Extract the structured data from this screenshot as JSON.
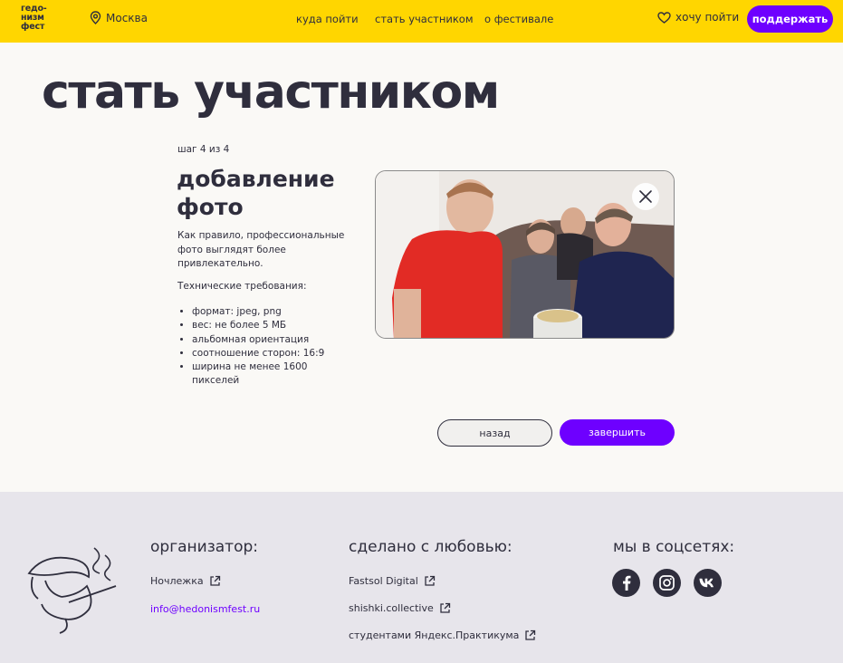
{
  "header": {
    "logo_lines": [
      "гедо-",
      "низм",
      "фест"
    ],
    "city": "Москва",
    "nav": [
      "куда пойти",
      "стать участником",
      "о фестивале"
    ],
    "favorites": "хочу пойти",
    "support_button": "поддержать",
    "colors": {
      "background": "#ffd600",
      "accent": "#6e00ff"
    }
  },
  "main": {
    "title": "стать участником",
    "step": "шаг 4 из 4",
    "section_title": "добавление фото",
    "intro": "Как правило, профессиональные фото выглядят более привлекательно.",
    "requirements_title": "Технические требования:",
    "requirements": [
      "формат: jpeg, png",
      "вес: не более 5 МБ",
      "альбомная ориентация",
      "соотношение сторон: 16:9",
      "ширина не менее 1600 пикселей"
    ],
    "back_button": "назад",
    "finish_button": "завершить"
  },
  "footer": {
    "organizer": {
      "title": "организатор:",
      "link": "Ночлежка",
      "email": "info@hedonismfest.ru"
    },
    "made_with_love": {
      "title": "сделано с любовью:",
      "links": [
        "Fastsol Digital",
        "shishki.collective",
        "студентами Яндекс.Практикума"
      ]
    },
    "social": {
      "title": "мы в соцсетях:",
      "icons": [
        "facebook-icon",
        "instagram-icon",
        "vk-icon"
      ]
    }
  }
}
